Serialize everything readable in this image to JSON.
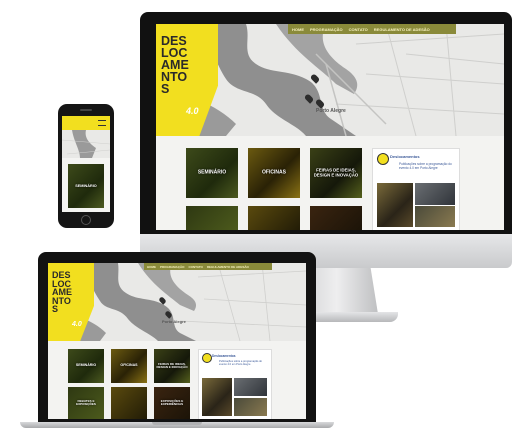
{
  "nav": {
    "items": [
      "HOME",
      "PROGRAMAÇÃO",
      "CONTATO",
      "REGULAMENTO DE ADESÃO"
    ]
  },
  "brand": {
    "title_lines": [
      "DES",
      "LOC",
      "AME",
      "NTO",
      "S"
    ],
    "number": "4.0",
    "laptop_title_lines": [
      "DES",
      "LOC",
      "AME",
      "NTO",
      "S"
    ]
  },
  "map": {
    "city_label": "Porto Alegre"
  },
  "tiles": {
    "seminario": "SEMINÁRIO",
    "oficinas": "OFICINAS",
    "feiras": "FEIRAS DE IDEIAS, DESIGN E INOVAÇÃO",
    "debates": "DEBATES E EXPOSIÇÕES",
    "exposicoes": "EXPOSIÇÕES E EXPERIÊNCIAS"
  },
  "social": {
    "page_name": "Deslocamentos",
    "post_text": "Publicações sobre a programação do evento 4.0 em Porto Alegre"
  },
  "colors": {
    "brand_yellow": "#f2df1f",
    "nav_olive": "#8a8a3a",
    "device_black": "#111111",
    "monitor_silver": "#d9dadc"
  }
}
